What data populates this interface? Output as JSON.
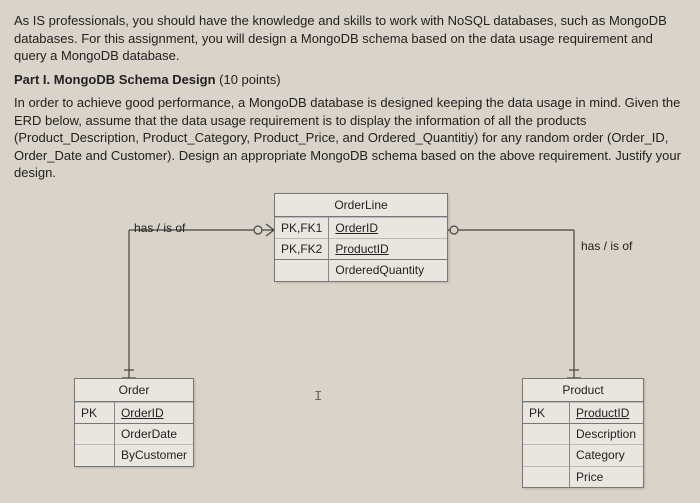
{
  "intro": "As IS professionals, you should have the knowledge and skills to work with NoSQL databases, such as MongoDB databases.  For this assignment, you will design a MongoDB schema based on the data usage requirement and query a MongoDB database.",
  "part_title": "Part I. MongoDB Schema Design",
  "part_points": " (10 points)",
  "part_body": "In order to achieve good performance, a MongoDB database is designed keeping the data usage in mind. Given the ERD below, assume that the data usage requirement is to display the information of all the products (Product_Description, Product_Category, Product_Price, and Ordered_Quantitiy) for any random order (Order_ID, Order_Date and Customer). Design an appropriate MongoDB schema based on the above requirement. Justify your design.",
  "rel_left": "has / is of",
  "rel_right": "has / is of",
  "cursor_glyph": "I",
  "entities": {
    "orderline": {
      "title": "OrderLine",
      "rows": [
        {
          "key": "PK,FK1",
          "attr": "OrderID",
          "ul": true
        },
        {
          "key": "PK,FK2",
          "attr": "ProductID",
          "ul": true
        },
        {
          "key": "",
          "attr": "OrderedQuantity",
          "ul": false
        }
      ]
    },
    "order": {
      "title": "Order",
      "rows": [
        {
          "key": "PK",
          "attr": "OrderID",
          "ul": true
        },
        {
          "key": "",
          "attr": "OrderDate",
          "ul": false
        },
        {
          "key": "",
          "attr": "ByCustomer",
          "ul": false
        }
      ]
    },
    "product": {
      "title": "Product",
      "rows": [
        {
          "key": "PK",
          "attr": "ProductID",
          "ul": true
        },
        {
          "key": "",
          "attr": "Description",
          "ul": false
        },
        {
          "key": "",
          "attr": "Category",
          "ul": false
        },
        {
          "key": "",
          "attr": "Price",
          "ul": false
        }
      ]
    }
  }
}
